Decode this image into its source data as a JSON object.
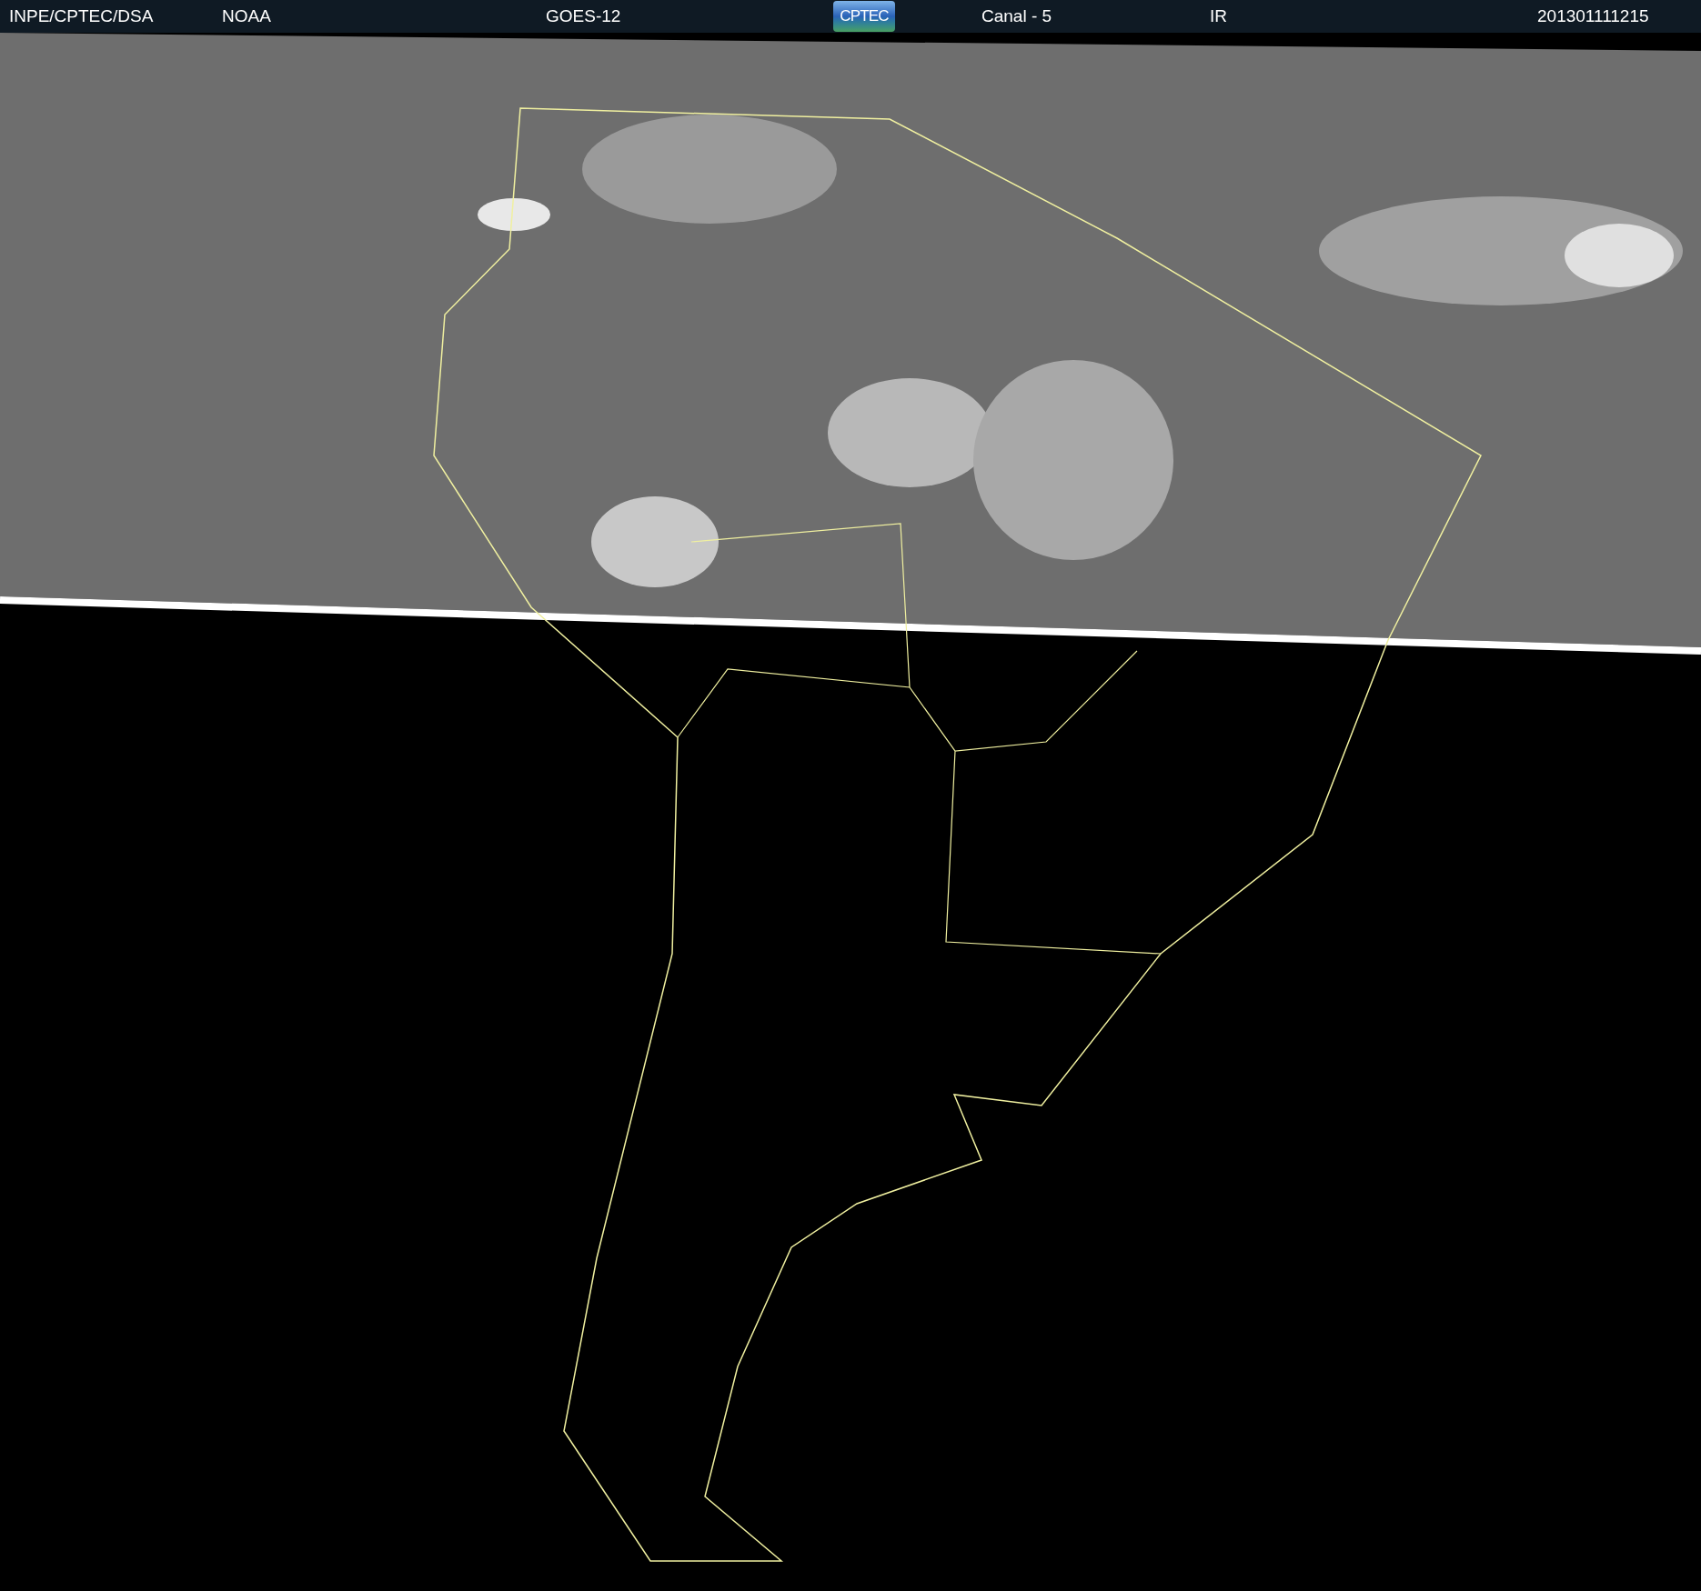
{
  "header": {
    "source": "INPE/CPTEC/DSA",
    "agency": "NOAA",
    "satellite": "GOES-12",
    "logo": "CPTEC",
    "channel": "Canal - 5",
    "band": "IR",
    "timestamp": "201301111215"
  }
}
